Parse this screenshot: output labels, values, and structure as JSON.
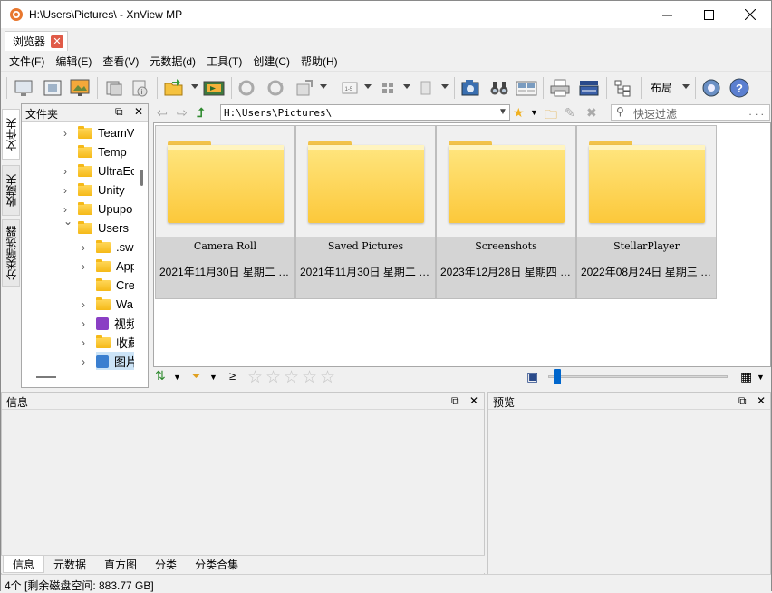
{
  "window": {
    "title": "H:\\Users\\Pictures\\ - XnView MP",
    "minimize": "─",
    "maximize": "☐",
    "close": "✕"
  },
  "tab": {
    "label": "浏览器"
  },
  "menu": [
    "文件(F)",
    "编辑(E)",
    "查看(V)",
    "元数据(d)",
    "工具(T)",
    "创建(C)",
    "帮助(H)"
  ],
  "toolbar": {
    "layout_label": "布局",
    "range_label": "1-5"
  },
  "vtabs": [
    "文件夹",
    "收藏夹",
    "分类筛选器"
  ],
  "folder_pane": {
    "title": "文件夹",
    "tree": [
      {
        "label": "TeamV",
        "expandable": true,
        "indent": 0,
        "icon": "folder-icon"
      },
      {
        "label": "Temp",
        "expandable": false,
        "indent": 0,
        "icon": "folder-icon"
      },
      {
        "label": "UltraEc",
        "expandable": true,
        "indent": 0,
        "icon": "folder-icon"
      },
      {
        "label": "Unity",
        "expandable": true,
        "indent": 0,
        "icon": "folder-icon"
      },
      {
        "label": "Upupo",
        "expandable": true,
        "indent": 0,
        "icon": "folder-icon"
      },
      {
        "label": "Users",
        "expandable": true,
        "expanded": true,
        "indent": 0,
        "icon": "folder-icon"
      },
      {
        "label": ".sw",
        "expandable": true,
        "indent": 1,
        "icon": "folder-icon"
      },
      {
        "label": "App",
        "expandable": true,
        "indent": 1,
        "icon": "folder-icon"
      },
      {
        "label": "Cre",
        "expandable": false,
        "indent": 1,
        "icon": "folder-icon"
      },
      {
        "label": "Wa",
        "expandable": true,
        "indent": 1,
        "icon": "folder-icon"
      },
      {
        "label": "视频",
        "expandable": true,
        "indent": 1,
        "icon": "video-folder-icon"
      },
      {
        "label": "收藏",
        "expandable": true,
        "indent": 1,
        "icon": "folder-icon"
      },
      {
        "label": "图片",
        "expandable": true,
        "indent": 1,
        "icon": "pictures-folder-icon",
        "selected": true
      }
    ]
  },
  "address": {
    "path": "H:\\Users\\Pictures\\",
    "filter_placeholder": "快速过滤",
    "filter_more": ". . ."
  },
  "thumbnails": [
    {
      "name": "Camera Roll",
      "date": "2021年11月30日 星期二 …"
    },
    {
      "name": "Saved Pictures",
      "date": "2021年11月30日 星期二 …"
    },
    {
      "name": "Screenshots",
      "date": "2023年12月28日 星期四 …"
    },
    {
      "name": "StellarPlayer",
      "date": "2022年08月24日 星期三 …"
    }
  ],
  "browser_bar": {
    "ge_symbol": "≥",
    "rating_stars": 0,
    "rating_max": 5,
    "zoom_fraction": 0.03
  },
  "info_panel": {
    "title": "信息",
    "tabs": [
      "信息",
      "元数据",
      "直方图",
      "分类",
      "分类合集"
    ],
    "active_tab": 0
  },
  "preview_panel": {
    "title": "预览"
  },
  "status": {
    "text": "4个 [剩余磁盘空间: 883.77 GB]"
  },
  "colors": {
    "accent": "#0066cc",
    "folder": "#fcc83a",
    "tab_close": "#e05a47"
  }
}
